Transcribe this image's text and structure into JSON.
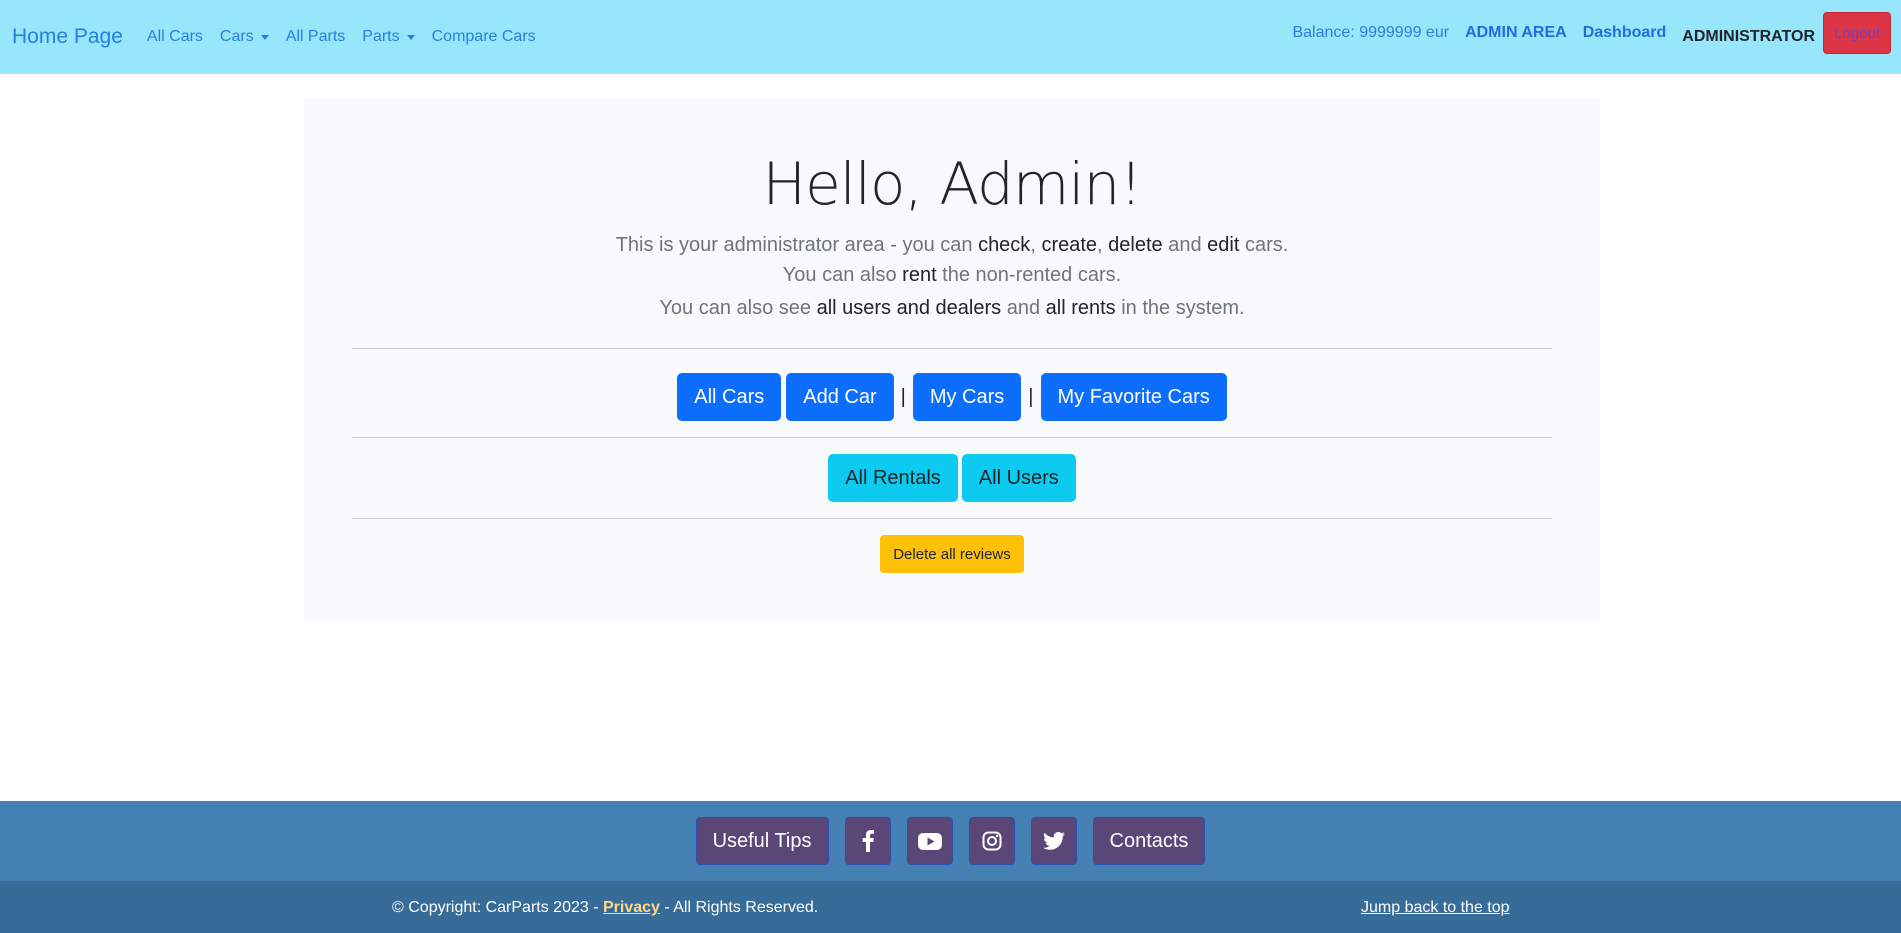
{
  "nav": {
    "brand": "Home Page",
    "links": [
      "All Cars",
      "Cars",
      "All Parts",
      "Parts",
      "Compare Cars"
    ],
    "balance": "Balance: 9999999 eur",
    "admin_area": "ADMIN AREA",
    "dashboard": "Dashboard",
    "role": "ADMINISTRATOR",
    "logout": "Logout"
  },
  "main": {
    "title": "Hello, Admin!",
    "line1": {
      "a": "This is your administrator area - you can ",
      "check": "check",
      "c1": ", ",
      "create": "create",
      "c2": ", ",
      "delete": "delete",
      "and": " and ",
      "edit": "edit",
      "end": " cars."
    },
    "line2": {
      "a": "You can also ",
      "rent": "rent",
      "end": " the non-rented cars."
    },
    "line3": {
      "a": "You can also see ",
      "users": "all users and dealers",
      "and": " and ",
      "rents": "all rents",
      "end": " in the system."
    },
    "row1": {
      "all_cars": "All Cars",
      "add_car": "Add Car",
      "sep": "|",
      "my_cars": "My Cars",
      "my_fav": "My Favorite Cars"
    },
    "row2": {
      "all_rentals": "All Rentals",
      "all_users": "All Users"
    },
    "delete_reviews": "Delete all reviews"
  },
  "footer": {
    "useful_tips": "Useful Tips",
    "icons": [
      "facebook-icon",
      "youtube-icon",
      "instagram-icon",
      "twitter-icon"
    ],
    "contacts": "Contacts",
    "copyright_prefix": "© Copyright: CarParts 2023 - ",
    "privacy": "Privacy",
    "copyright_suffix": " - All Rights Reserved.",
    "jump": "Jump back to the top"
  },
  "colors": {
    "navbar": "#97e6fc",
    "primary": "#0d6efd",
    "info": "#0dcaf0",
    "warning": "#ffc107",
    "danger": "#dc3545",
    "footer_top": "#4580b4",
    "footer_bottom": "#376c99"
  }
}
